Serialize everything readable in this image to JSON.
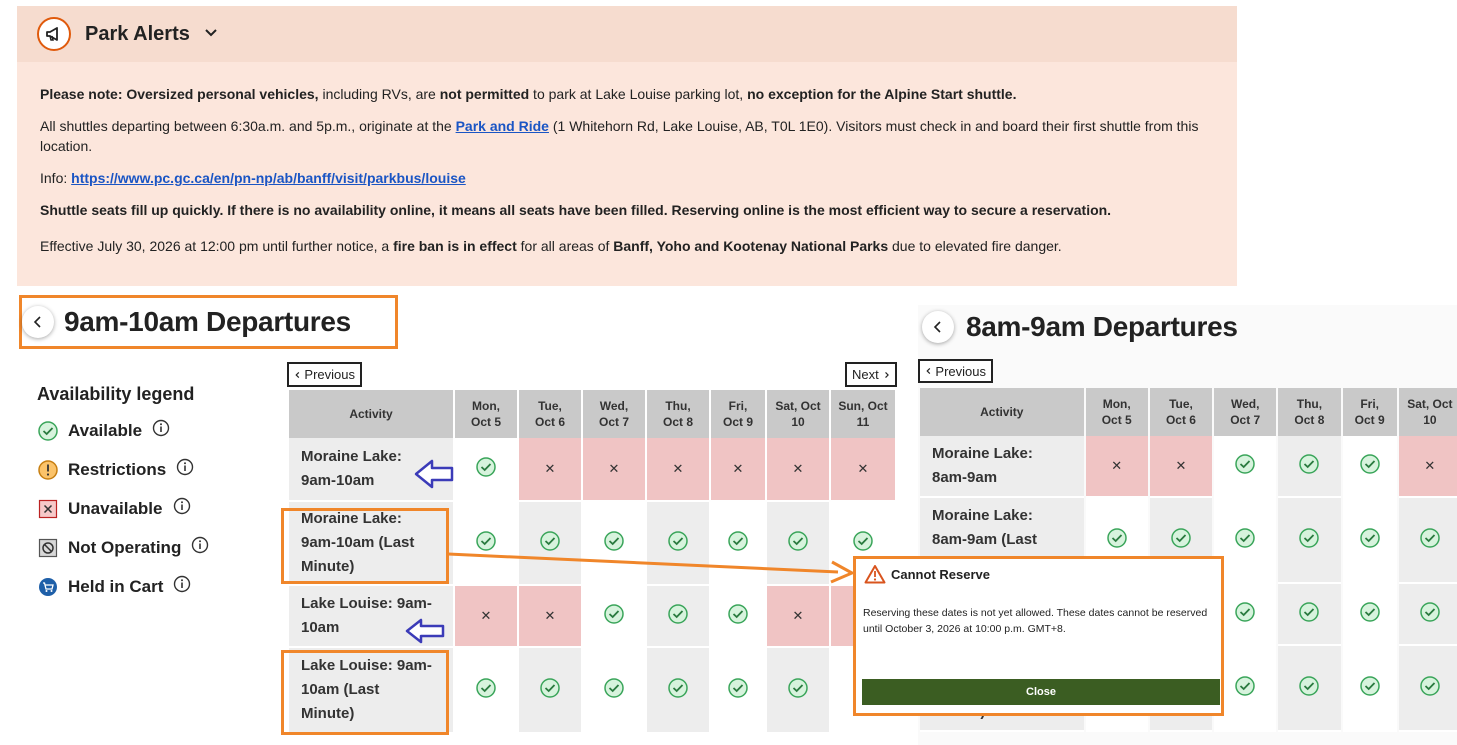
{
  "alerts": {
    "title": "Park Alerts",
    "line1_prefix": "Please note: Oversized personal vehicles,",
    "line1_mid": " including RVs, are ",
    "line1_bold2": "not permitted",
    "line1_mid2": " to park at Lake Louise parking lot, ",
    "line1_bold3": "no exception for the Alpine Start shuttle.",
    "line2_prefix": "All shuttles departing between 6:30a.m. and 5p.m., originate at the ",
    "line2_link": "Park and Ride",
    "line2_suffix": " (1 Whitehorn Rd, Lake Louise, AB, T0L 1E0). Visitors must check in and board their first shuttle from this location.",
    "info_label": "Info: ",
    "info_link": "https://www.pc.gc.ca/en/pn-np/ab/banff/visit/parkbus/louise",
    "line3": "Shuttle seats fill up quickly. If there is no availability online, it means all seats have been filled. Reserving online is the most efficient way to secure a reservation.",
    "line4_prefix": "Effective July 30, 2026 at 12:00 pm until further notice, a ",
    "line4_bold1": "fire ban is in effect",
    "line4_mid": " for all areas of ",
    "line4_bold2": "Banff, Yoho and Kootenay National Parks",
    "line4_suffix": " due to elevated fire danger."
  },
  "left": {
    "title": "9am-10am Departures",
    "previous": "Previous",
    "next": "Next",
    "header_activity": "Activity",
    "days": [
      [
        "Mon,",
        "Oct 5"
      ],
      [
        "Tue,",
        "Oct 6"
      ],
      [
        "Wed,",
        "Oct 7"
      ],
      [
        "Thu,",
        "Oct 8"
      ],
      [
        "Fri,",
        "Oct 9"
      ],
      [
        "Sat, Oct",
        "10"
      ],
      [
        "Sun, Oct",
        "11"
      ]
    ],
    "rows": [
      {
        "label": [
          "Moraine Lake:",
          "9am-10am"
        ],
        "cells": [
          "ok",
          "no",
          "no",
          "no",
          "no",
          "no",
          "no"
        ]
      },
      {
        "label": [
          "Moraine Lake:",
          "9am-10am (Last",
          "Minute)"
        ],
        "cells": [
          "ok",
          "ok",
          "ok",
          "ok",
          "ok",
          "ok",
          "ok"
        ]
      },
      {
        "label": [
          "Lake Louise: 9am-",
          "10am"
        ],
        "cells": [
          "no",
          "no",
          "ok",
          "ok",
          "ok",
          "no",
          "no"
        ]
      },
      {
        "label": [
          "Lake Louise: 9am-",
          "10am (Last",
          "Minute)"
        ],
        "cells": [
          "ok",
          "ok",
          "ok",
          "ok",
          "ok",
          "ok",
          "ok"
        ]
      }
    ]
  },
  "legend": {
    "title": "Availability legend",
    "items": [
      "Available",
      "Restrictions",
      "Unavailable",
      "Not Operating",
      "Held in Cart"
    ]
  },
  "right": {
    "title": "8am-9am Departures",
    "previous": "Previous",
    "header_activity": "Activity",
    "days": [
      [
        "Mon,",
        "Oct 5"
      ],
      [
        "Tue,",
        "Oct 6"
      ],
      [
        "Wed,",
        "Oct 7"
      ],
      [
        "Thu,",
        "Oct 8"
      ],
      [
        "Fri,",
        "Oct 9"
      ],
      [
        "Sat, Oct",
        "10"
      ]
    ],
    "rows": [
      {
        "label": [
          "Moraine Lake:",
          "8am-9am"
        ],
        "cells": [
          "no",
          "no",
          "ok",
          "ok",
          "ok",
          "no"
        ]
      },
      {
        "label": [
          "Moraine Lake:",
          "8am-9am (Last",
          "Minute)"
        ],
        "cells": [
          "ok",
          "ok",
          "ok",
          "ok",
          "ok",
          "ok"
        ]
      },
      {
        "label": [
          "",
          ""
        ],
        "cells": [
          "",
          "",
          "ok",
          "ok",
          "ok",
          "ok"
        ]
      },
      {
        "label": [
          "",
          "",
          "Minute)"
        ],
        "cells": [
          "",
          "",
          "ok",
          "ok",
          "ok",
          "ok"
        ]
      }
    ]
  },
  "modal": {
    "title": "Cannot Reserve",
    "text": "Reserving these dates is not yet allowed. These dates cannot be reserved until October 3, 2026 at 10:00 p.m. GMT+8.",
    "close": "Close"
  },
  "colors": {
    "accent_orange": "#f0862a",
    "unavailable": "#f0c4c4",
    "available_green": "#3aa55a",
    "close_button": "#3b5d22",
    "link_blue": "#1a55c4",
    "arrow_blue": "#3b3bb8"
  }
}
